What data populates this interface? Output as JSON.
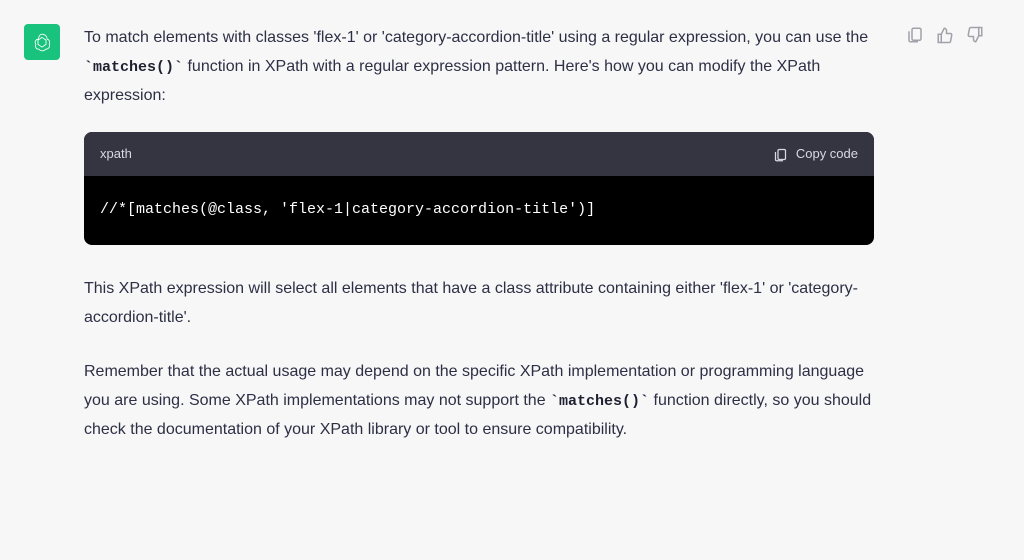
{
  "message": {
    "intro_parts": [
      "To match elements with classes 'flex-1' or 'category-accordion-title' using a regular expression, you can use the ",
      " function in XPath with a regular expression pattern. Here's how you can modify the XPath expression:"
    ],
    "intro_code": "`matches()`",
    "code": {
      "lang": "xpath",
      "copy_label": "Copy code",
      "content": "//*[matches(@class, 'flex-1|category-accordion-title')]"
    },
    "after": "This XPath expression will select all elements that have a class attribute containing either 'flex-1' or 'category-accordion-title'.",
    "note_parts": [
      "Remember that the actual usage may depend on the specific XPath implementation or programming language you are using. Some XPath implementations may not support the ",
      " function directly, so you should check the documentation of your XPath library or tool to ensure compatibility."
    ],
    "note_code": "`matches()`"
  }
}
